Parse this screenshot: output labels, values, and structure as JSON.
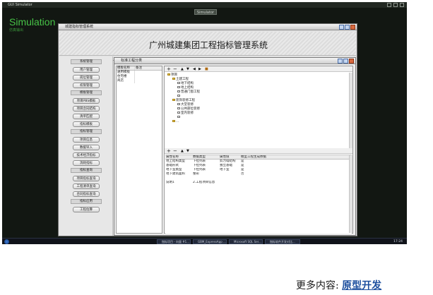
{
  "simulator": {
    "window_title": "GUI Simulator",
    "center_tab": "Simulator",
    "brand": "Simulation",
    "subtitle": "仿真输出"
  },
  "app": {
    "window_title": "城建指标管理系统",
    "banner_title": "广州城建集团工程指标管理系统",
    "nav": [
      {
        "type": "header",
        "label": "系统管理"
      },
      {
        "type": "button",
        "label": "用户管理"
      },
      {
        "type": "button",
        "label": "岗位管理"
      },
      {
        "type": "button",
        "label": "权限管理"
      },
      {
        "type": "header",
        "label": "模板管理"
      },
      {
        "type": "button",
        "label": "项目PBS模板"
      },
      {
        "type": "button",
        "label": "项目合同结构"
      },
      {
        "type": "button",
        "label": "清单匹配"
      },
      {
        "type": "button",
        "label": "指标模板"
      },
      {
        "type": "header",
        "label": "指标管理"
      },
      {
        "type": "button",
        "label": "项目信息"
      },
      {
        "type": "button",
        "label": "数据导入"
      },
      {
        "type": "button",
        "label": "技术经济指标"
      },
      {
        "type": "button",
        "label": "消耗指标"
      },
      {
        "type": "header",
        "label": "指标查询"
      },
      {
        "type": "button",
        "label": "项目指标查询"
      },
      {
        "type": "button",
        "label": "工程清单查询"
      },
      {
        "type": "button",
        "label": "合同指标查询"
      },
      {
        "type": "header",
        "label": "指标应用"
      },
      {
        "type": "button",
        "label": "工程估算"
      }
    ]
  },
  "inner": {
    "window_title": "标准工程分类",
    "template_table": {
      "headers": [
        "模板名称",
        "备注"
      ],
      "rows": [
        [
          "通用模板",
          ""
        ],
        [
          "住宅楼",
          ""
        ],
        [
          "商店",
          ""
        ]
      ]
    },
    "tree": [
      {
        "level": 0,
        "kind": "folder",
        "label": "项目"
      },
      {
        "level": 1,
        "kind": "folder",
        "label": "土建工程"
      },
      {
        "level": 2,
        "kind": "doc",
        "label": "地下结构"
      },
      {
        "level": 2,
        "kind": "doc",
        "label": "地上结构"
      },
      {
        "level": 2,
        "kind": "doc",
        "label": "普通门窗工程"
      },
      {
        "level": 2,
        "kind": "doc",
        "label": ""
      },
      {
        "level": 1,
        "kind": "folder",
        "label": "装饰装修工程"
      },
      {
        "level": 2,
        "kind": "doc",
        "label": "大堂装修"
      },
      {
        "level": 2,
        "kind": "doc",
        "label": "公共部位装修"
      },
      {
        "level": 2,
        "kind": "doc",
        "label": "室内装修"
      },
      {
        "level": 2,
        "kind": "doc",
        "label": ""
      },
      {
        "level": 1,
        "kind": "folder",
        "label": "..."
      }
    ],
    "property_table": {
      "headers": [
        "属性名称",
        "数据类型",
        "属性值",
        "模型工程生成依据"
      ],
      "rows": [
        [
          "地上结构类型",
          "下拉列表",
          "剪力墙结构",
          "是"
        ],
        [
          "基础形式",
          "下拉列表",
          "独立基础",
          "是"
        ],
        [
          "地下室类型",
          "下拉列表",
          "地下室",
          "是"
        ],
        [
          "地下建筑面积",
          "整形",
          "",
          "否"
        ],
        [
          "",
          "",
          "",
          ""
        ],
        [
          "说明1",
          "2.工程项目信息",
          "",
          ""
        ]
      ]
    }
  },
  "taskbar": {
    "items": [
      "指标项目 - 向量 #1...",
      "GBM_ExpressApp ...",
      "Microsoft SQL Ser...",
      "指标软件开发对比..."
    ],
    "clock": "17:24"
  },
  "footer": {
    "prefix": "更多内容:",
    "link": "原型开发"
  }
}
